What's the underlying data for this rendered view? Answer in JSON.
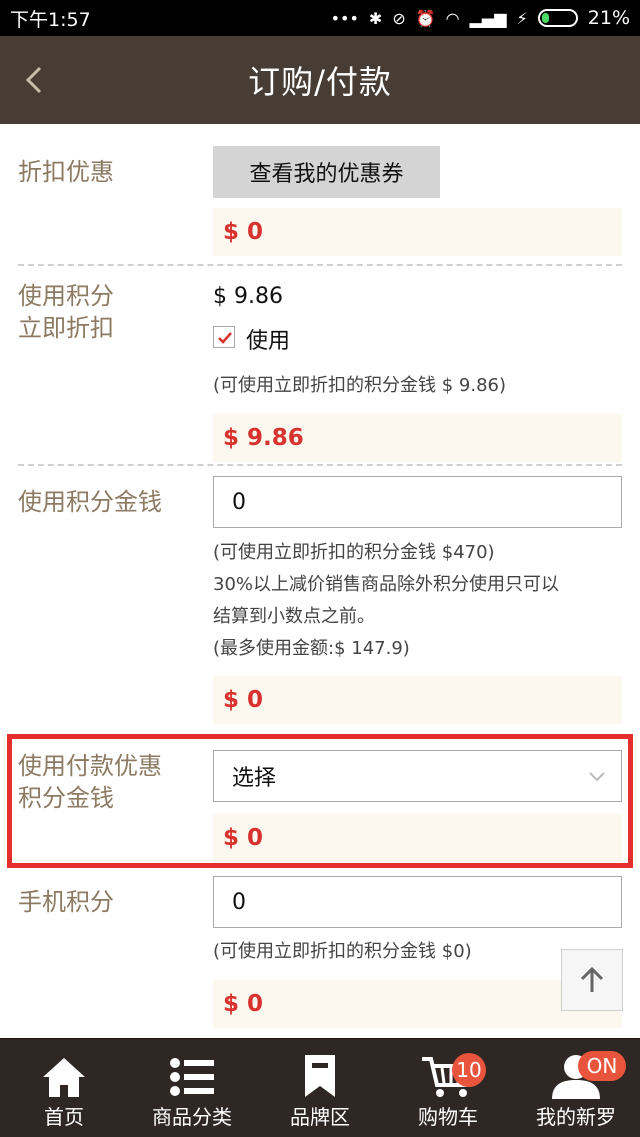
{
  "status_bar": {
    "time": "下午1:57",
    "battery": "21%"
  },
  "header": {
    "title": "订购/付款",
    "back_icon": "chevron-left-icon"
  },
  "discount": {
    "label": "折扣优惠",
    "button": "查看我的优惠券",
    "amount": "$ 0"
  },
  "points_instant": {
    "label_line1": "使用积分",
    "label_line2": "立即折扣",
    "value": "$ 9.86",
    "checkbox_label": "使用",
    "checked": true,
    "note": "(可使用立即折扣的积分金钱 $ 9.86)",
    "amount": "$ 9.86"
  },
  "points_money": {
    "label": "使用积分金钱",
    "input_value": "0",
    "note_line1": "(可使用立即折扣的积分金钱 $470)",
    "note_line2": "30%以上减价销售商品除外积分使用只可以",
    "note_line3": "结算到小数点之前。",
    "note_line4": "(最多使用金额:$ 147.9)",
    "amount": "$ 0"
  },
  "payment_points": {
    "label_line1": "使用付款优惠",
    "label_line2": "积分金钱",
    "select_value": "选择",
    "amount": "$ 0"
  },
  "mobile_points": {
    "label": "手机积分",
    "input_value": "0",
    "note": "(可使用立即折扣的积分金钱 $0)",
    "amount": "$ 0"
  },
  "tabbar": {
    "items": [
      {
        "label": "首页",
        "icon": "home-icon"
      },
      {
        "label": "商品分类",
        "icon": "list-icon"
      },
      {
        "label": "品牌区",
        "icon": "bookmark-icon"
      },
      {
        "label": "购物车",
        "icon": "cart-icon",
        "badge": "10"
      },
      {
        "label": "我的新罗",
        "icon": "user-icon",
        "badge": "ON"
      }
    ]
  },
  "colors": {
    "header_bg": "#483d34",
    "label": "#8c7a62",
    "amount": "#d8322e",
    "highlight_border": "#e52e2e"
  }
}
